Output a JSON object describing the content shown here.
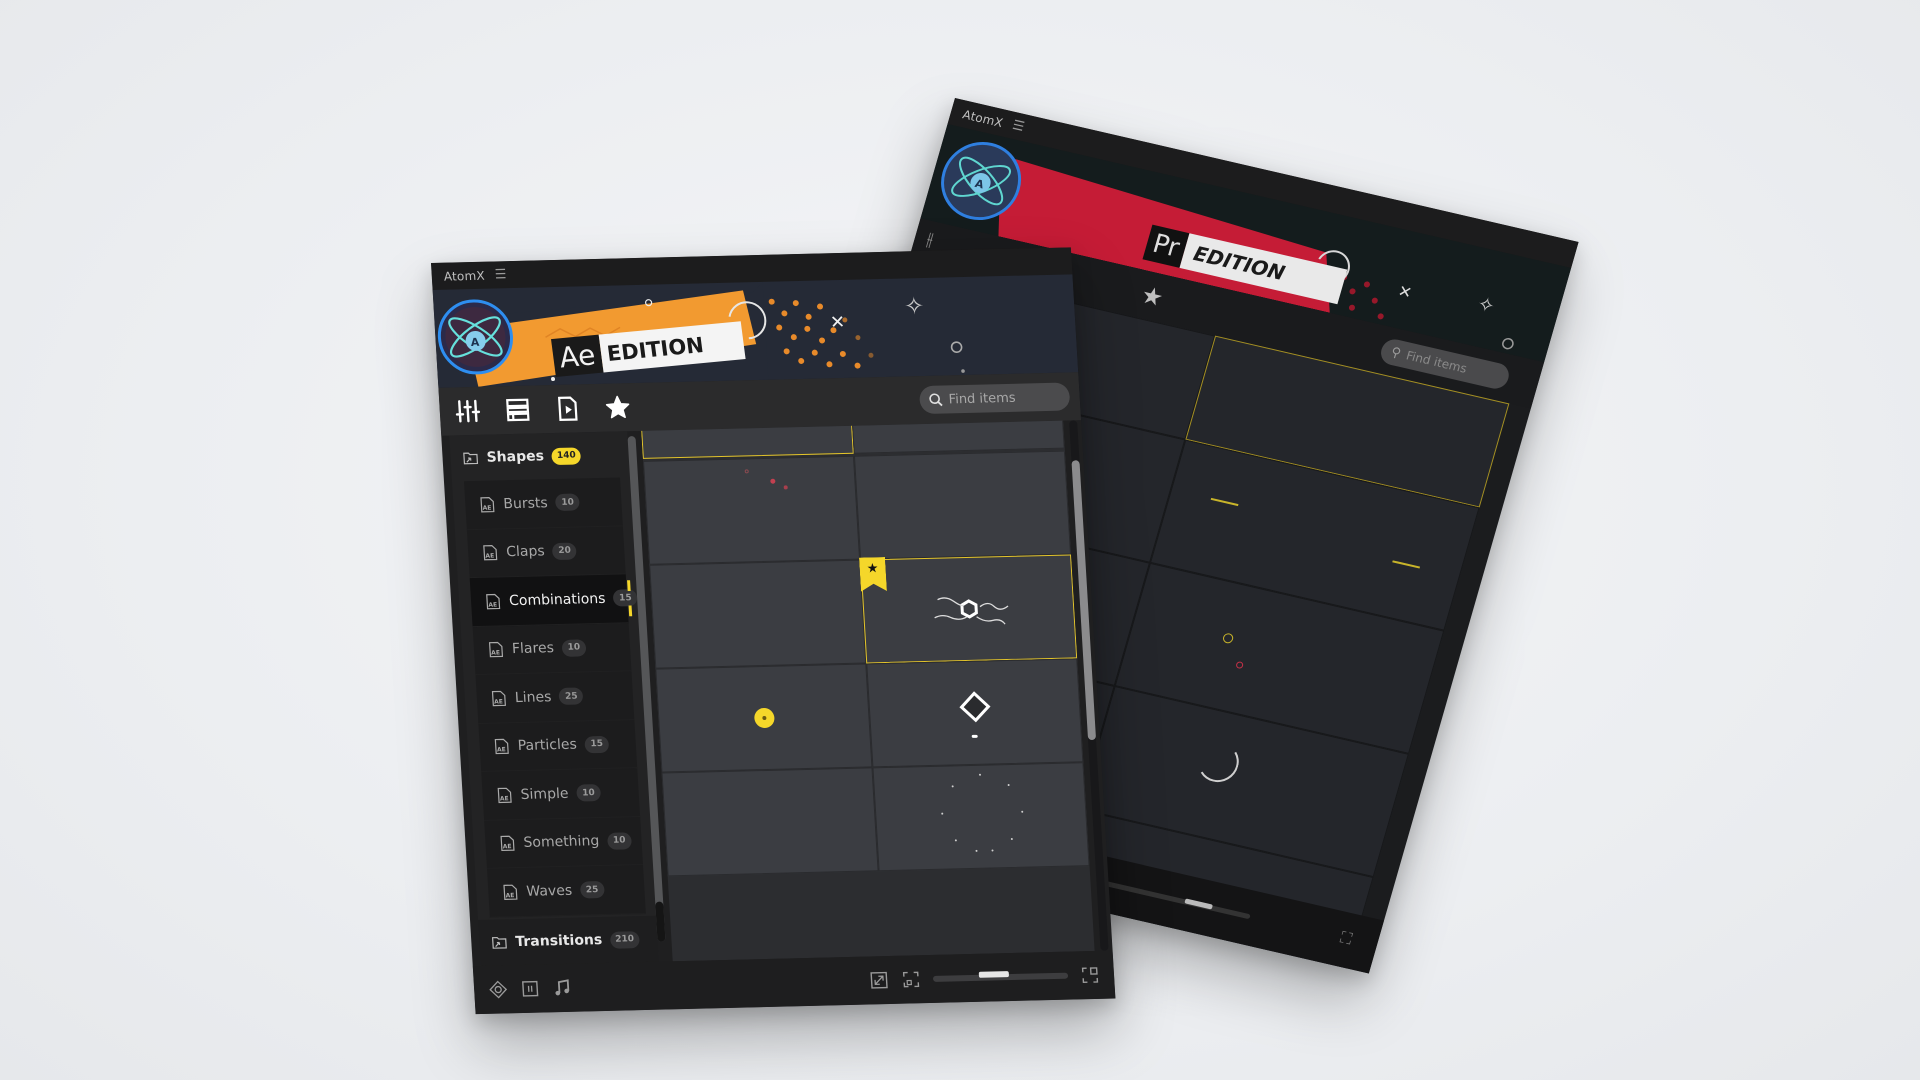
{
  "back_window": {
    "app_name": "AtomX",
    "edition_app": "Pr",
    "edition_label": "EDITION",
    "search_placeholder": "Find items",
    "accent_color": "#d8203a",
    "zoom_level": 0.55
  },
  "front_window": {
    "app_name": "AtomX",
    "edition_app": "Ae",
    "edition_label": "EDITION",
    "accent_color": "#f29a30",
    "toolbar": {
      "icons": [
        "sliders-icon",
        "list-view-icon",
        "media-file-icon",
        "favorites-star-icon"
      ],
      "search_placeholder": "Find items",
      "search_value": ""
    },
    "sidebar": {
      "categories": [
        {
          "label": "Shapes",
          "count": "140",
          "expanded": true,
          "items": [
            {
              "label": "Bursts",
              "count": "10"
            },
            {
              "label": "Claps",
              "count": "20"
            },
            {
              "label": "Combinations",
              "count": "15",
              "active": true
            },
            {
              "label": "Flares",
              "count": "10"
            },
            {
              "label": "Lines",
              "count": "25"
            },
            {
              "label": "Particles",
              "count": "15"
            },
            {
              "label": "Simple",
              "count": "10"
            },
            {
              "label": "Something",
              "count": "10"
            },
            {
              "label": "Waves",
              "count": "25"
            }
          ]
        },
        {
          "label": "Transitions",
          "count": "210",
          "expanded": false
        }
      ]
    },
    "grid": {
      "selection_color": "#e4c52a",
      "favorite_badge_color": "#f5d72a",
      "cards": [
        {
          "preview": "blank",
          "selected": true
        },
        {
          "preview": "blank"
        },
        {
          "preview": "red-particles"
        },
        {
          "preview": "blank"
        },
        {
          "preview": "blank"
        },
        {
          "preview": "white-hexagon-waves",
          "selected": true,
          "favorite": true
        },
        {
          "preview": "yellow-dot"
        },
        {
          "preview": "white-diamond"
        },
        {
          "preview": "blank"
        },
        {
          "preview": "dot-ring"
        }
      ]
    },
    "footer": {
      "left_icons": [
        "gamepad-icon",
        "pause-icon",
        "music-note-icon"
      ],
      "right_icons": [
        "expand-icon",
        "frame-icon",
        "fullscreen-icon"
      ],
      "zoom_level": 0.45
    }
  }
}
